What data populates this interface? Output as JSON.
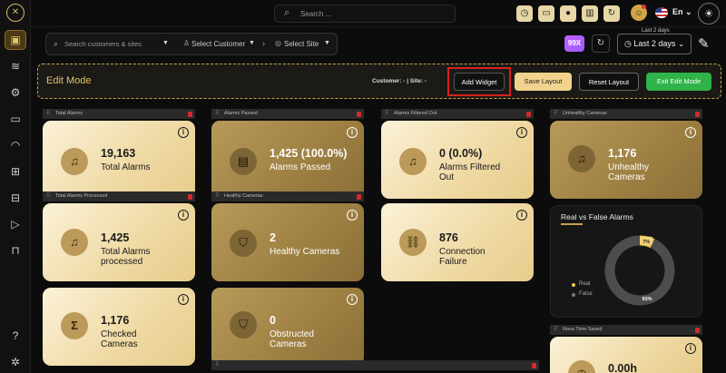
{
  "topbar": {
    "search_placeholder": "Search ...",
    "language": "En",
    "logo_glyph": "✕"
  },
  "filters": {
    "search_placeholder": "Search customers & sites",
    "customer": "Select Customer",
    "site": "Select Site"
  },
  "date_range": {
    "legend": "Last 2 days",
    "value": "Last 2 days",
    "badge": "99X"
  },
  "edit_bar": {
    "title": "Edit Mode",
    "customer_site": "Customer: - | Site: -",
    "add_widget": "Add Widget",
    "save_layout": "Save Layout",
    "reset_layout": "Reset Layout",
    "exit_edit_mode": "Exit Edit Mode"
  },
  "widgets": {
    "total_alarms": {
      "header": "Total Alarms",
      "value": "19,163",
      "label": "Total Alarms"
    },
    "alarms_passed": {
      "header": "Alarms Passed",
      "value": "1,425 (100.0%)",
      "label": "Alarms Passed"
    },
    "alarms_filtered": {
      "header": "Alarms Filtered Out",
      "value": "0 (0.0%)",
      "label1": "Alarms Filtered",
      "label2": "Out"
    },
    "unhealthy": {
      "header": "Unhealthy Cameras",
      "value": "1,176",
      "label1": "Unhealthy",
      "label2": "Cameras"
    },
    "processed": {
      "header": "Total Alarms Processed",
      "value": "1,425",
      "label1": "Total Alarms",
      "label2": "processed"
    },
    "healthy": {
      "header": "Healthy Cameras",
      "value": "2",
      "label": "Healthy Cameras"
    },
    "connection": {
      "value": "876",
      "label1": "Connection",
      "label2": "Failure"
    },
    "checked": {
      "value": "1,176",
      "label1": "Checked",
      "label2": "Cameras"
    },
    "obstructed": {
      "value": "0",
      "label1": "Obstructed",
      "label2": "Cameras"
    },
    "time_saved": {
      "header": "Nova Time Saved",
      "value": "0.00h"
    },
    "info_glyph": "i"
  },
  "chart_data": {
    "type": "pie",
    "title": "Real vs False Alarms",
    "categories": [
      "Real",
      "False"
    ],
    "values": [
      7,
      93
    ],
    "labels": [
      "7%",
      "93%"
    ],
    "colors": {
      "Real": "#e9c55a",
      "False": "#4d4d4d"
    },
    "legend": "left"
  },
  "colors": {
    "accent": "#e3c06a",
    "exit_green": "#2fb34a",
    "highlight_red": "#d62020"
  }
}
